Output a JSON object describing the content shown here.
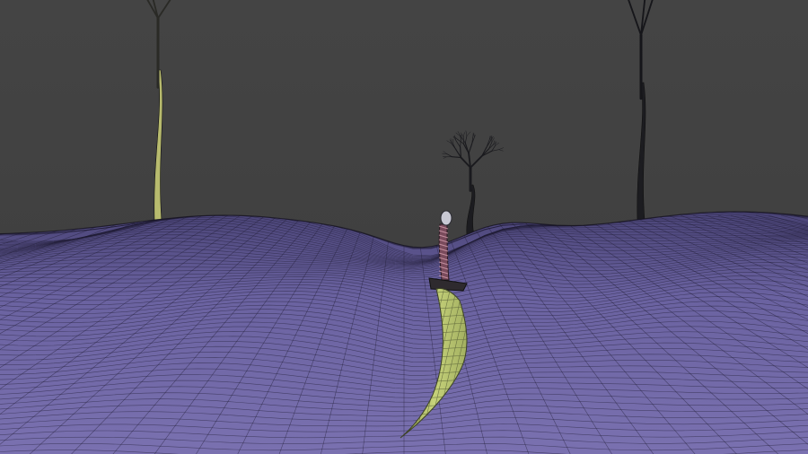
{
  "scene": {
    "colors": {
      "background": "#434343",
      "ground_fill": "#6d64a0",
      "ground_fill_dark": "#3c3763",
      "wire": "#1d1b2e",
      "tree": "#15151a",
      "tree_selected": "#c9cc7e",
      "blade": "#b7c46d",
      "hilt": "#8a5a6a"
    },
    "objects": [
      "terrain-wireframe-mesh",
      "bare-tree-left",
      "bare-tree-right",
      "bare-tree-small",
      "sword"
    ]
  }
}
